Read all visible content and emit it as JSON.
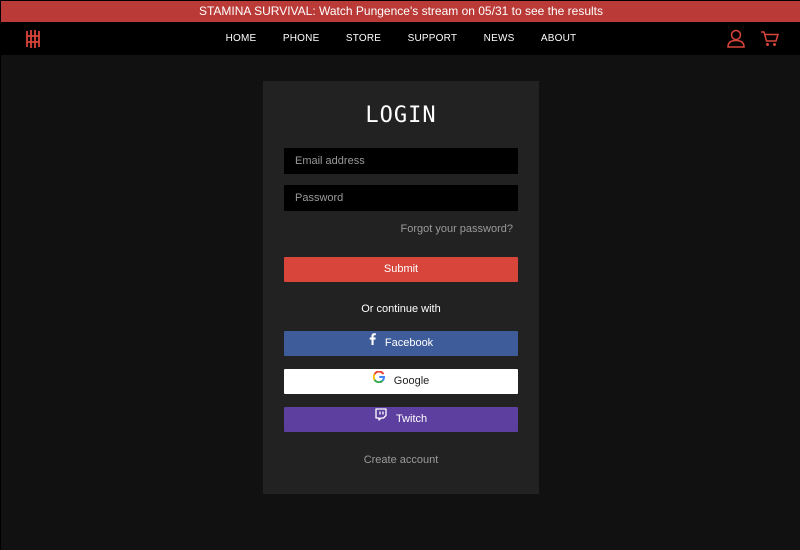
{
  "banner": {
    "text": "STAMINA SURVIVAL: Watch Pungence's stream on 05/31 to see the results"
  },
  "nav": {
    "items": [
      {
        "label": "HOME"
      },
      {
        "label": "PHONE"
      },
      {
        "label": "STORE"
      },
      {
        "label": "SUPPORT"
      },
      {
        "label": "NEWS"
      },
      {
        "label": "ABOUT"
      }
    ],
    "icons": {
      "logo": "red-magic-logo-icon",
      "account": "user-icon",
      "cart": "cart-icon"
    }
  },
  "login": {
    "title": "LOGIN",
    "email_placeholder": "Email address",
    "password_placeholder": "Password",
    "forgot_label": "Forgot your password?",
    "submit_label": "Submit",
    "continue_label": "Or continue with",
    "facebook_label": "Facebook",
    "google_label": "Google",
    "twitch_label": "Twitch",
    "create_label": "Create account"
  },
  "colors": {
    "banner": "#b93a37",
    "accent": "#d8453a",
    "facebook": "#3e5c9a",
    "twitch": "#5c3f9e",
    "card": "#222222",
    "background": "#111111"
  }
}
